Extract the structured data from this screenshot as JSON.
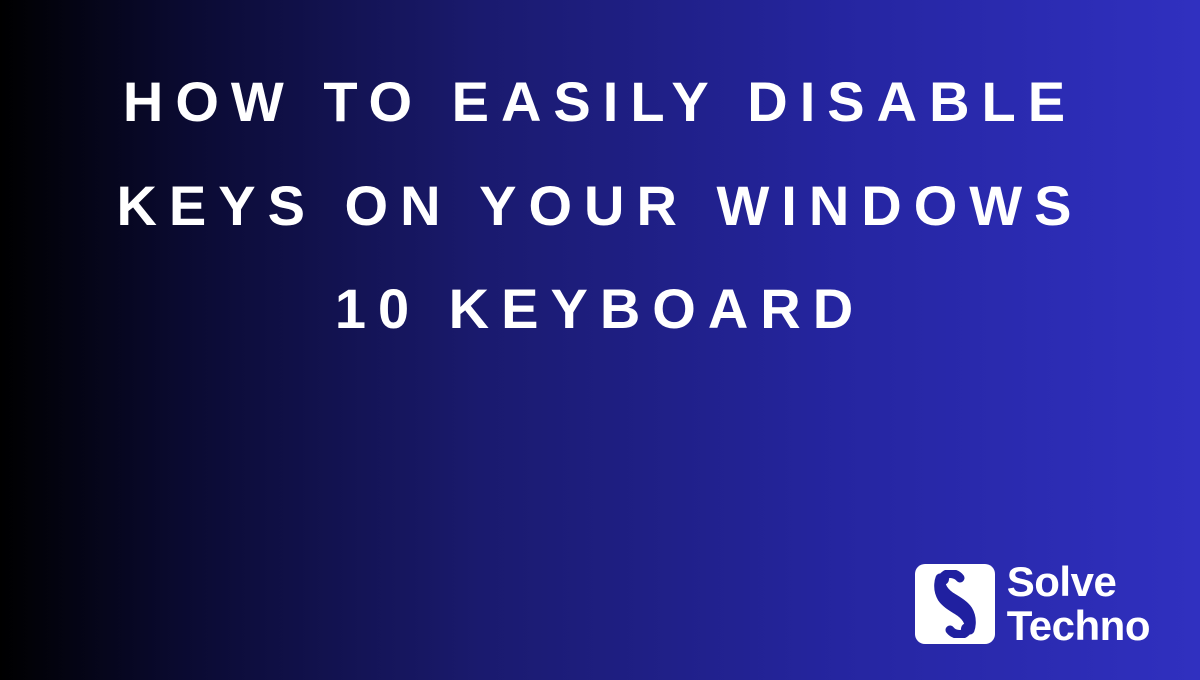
{
  "title": "HOW TO EASILY DISABLE KEYS ON YOUR WINDOWS 10 KEYBOARD",
  "brand": {
    "line1": "Solve",
    "line2": "Techno",
    "icon_name": "solve-techno-logo"
  },
  "colors": {
    "text": "#ffffff",
    "gradient_start": "#000000",
    "gradient_end": "#3030c0"
  }
}
